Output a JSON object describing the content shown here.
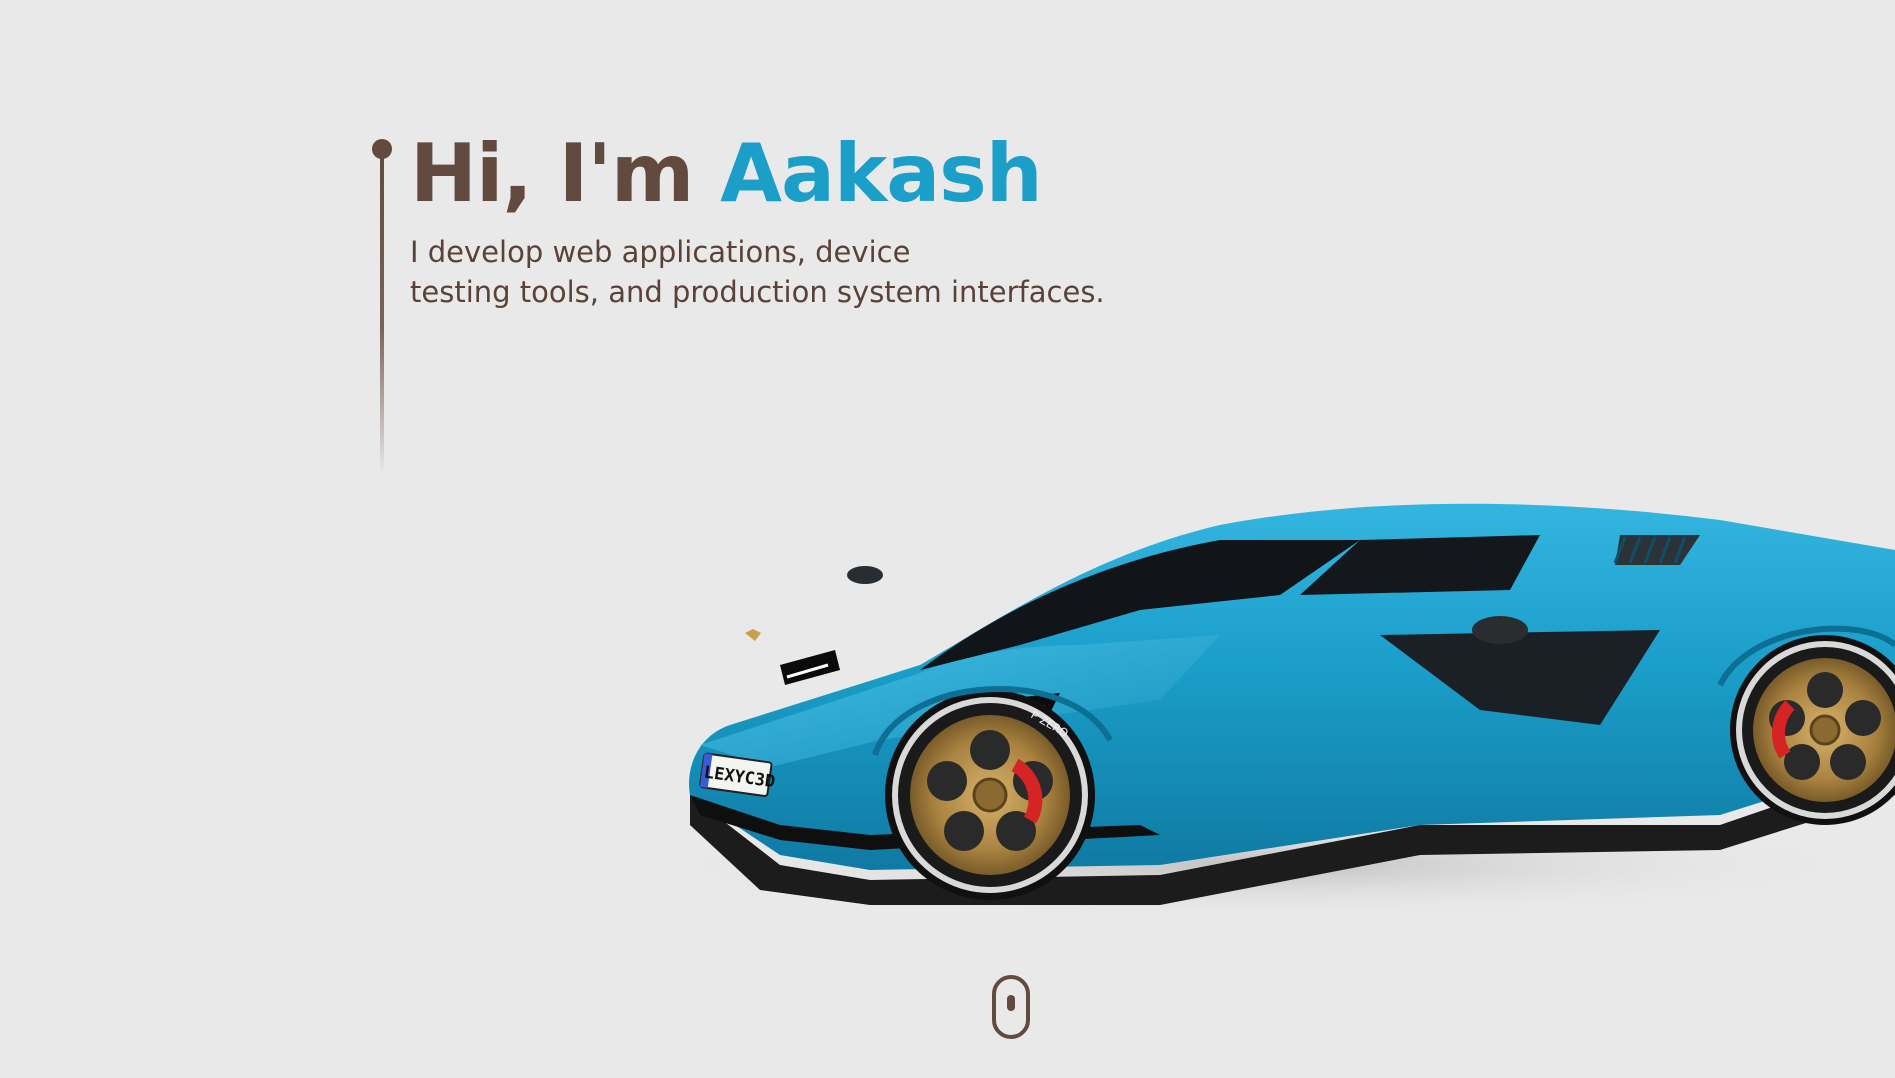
{
  "hero": {
    "greeting": "Hi, I'm",
    "name": "Aakash",
    "subtitle_line1": "I develop web applications, device",
    "subtitle_line2": "testing tools, and production system interfaces."
  },
  "car": {
    "plate": "LEXYC3D",
    "tire_brand": "P ZERO",
    "color": "#1a9ec9"
  },
  "colors": {
    "background": "#e9e9e9",
    "brown": "#634a3e",
    "accent_blue": "#1b9ec8"
  },
  "icons": {
    "scroll": "mouse-scroll-icon"
  }
}
